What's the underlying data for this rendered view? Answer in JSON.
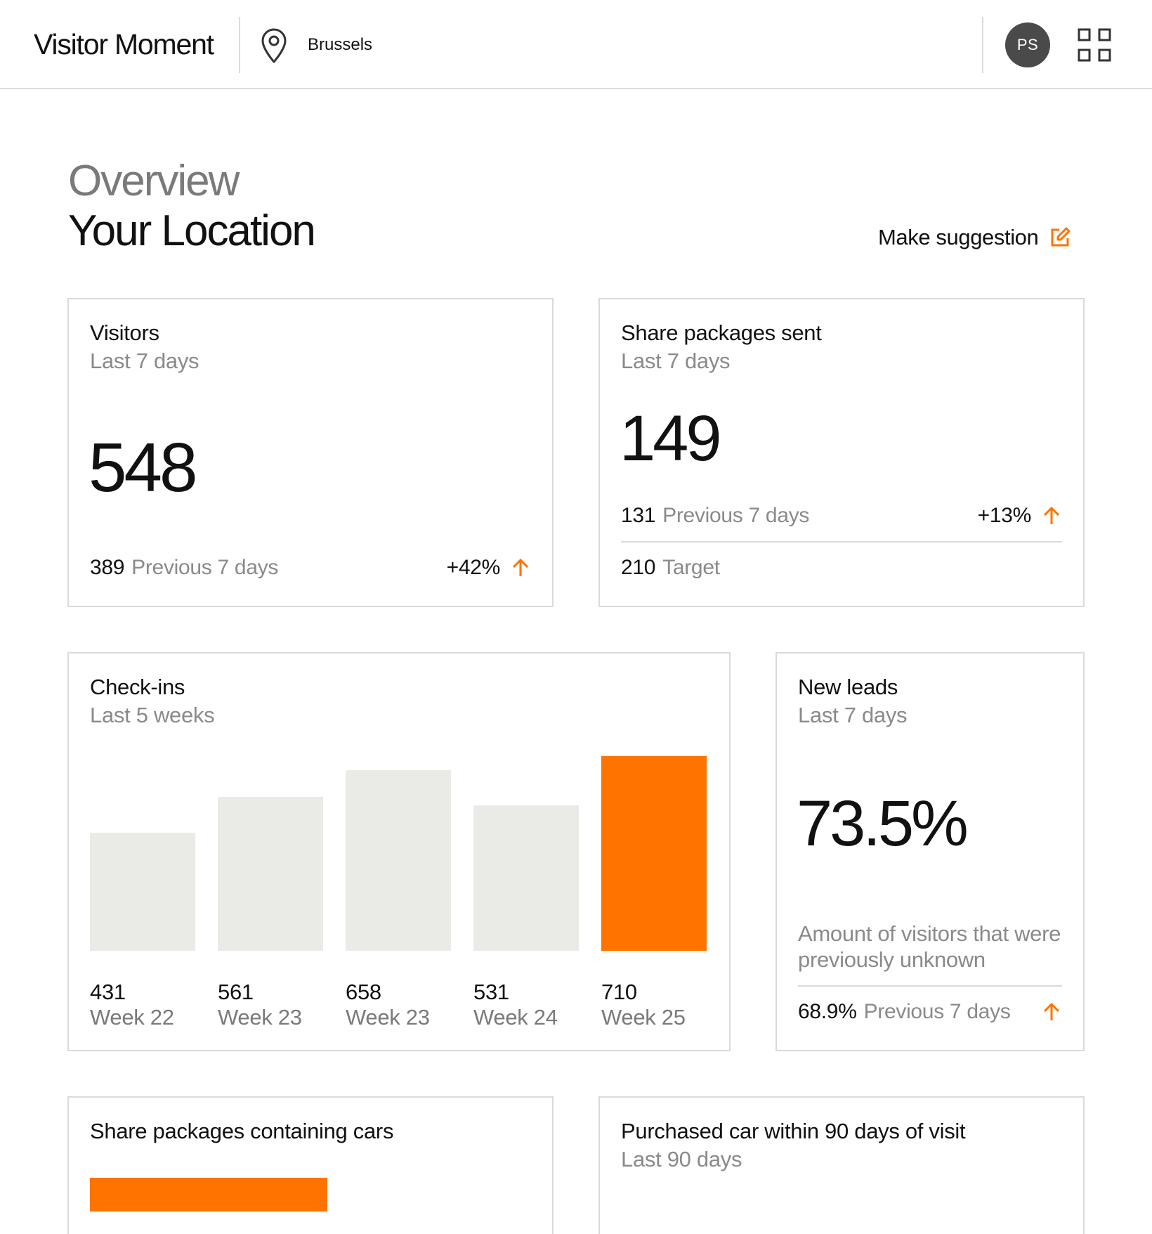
{
  "header": {
    "app_title": "Visitor Moment",
    "location": "Brussels",
    "avatar_initials": "PS",
    "icons": [
      "location-pin-icon",
      "apps-grid-icon"
    ]
  },
  "page": {
    "overview_label": "Overview",
    "title": "Your Location",
    "suggest_label": "Make suggestion",
    "suggest_icon": "edit-icon"
  },
  "colors": {
    "accent": "#FF7300",
    "bar_muted": "#EAEAE6",
    "border": "#DADADA",
    "muted_text": "#8A8A8A"
  },
  "visitors": {
    "title": "Visitors",
    "period": "Last 7 days",
    "value": "548",
    "previous_value": "389",
    "previous_label": "Previous 7 days",
    "change": "+42%",
    "trend": "up"
  },
  "share_packages": {
    "title": "Share packages sent",
    "period": "Last 7 days",
    "value": "149",
    "previous_value": "131",
    "previous_label": "Previous 7 days",
    "change": "+13%",
    "trend": "up",
    "target_value": "210",
    "target_label": "Target"
  },
  "checkins": {
    "title": "Check-ins",
    "period": "Last 5 weeks"
  },
  "chart_data": {
    "type": "bar",
    "title": "Check-ins",
    "subtitle": "Last 5 weeks",
    "categories": [
      "Week 22",
      "Week 23",
      "Week 23",
      "Week 24",
      "Week 25"
    ],
    "values": [
      431,
      561,
      658,
      531,
      710
    ],
    "highlight_index": 4,
    "ylim": [
      0,
      710
    ],
    "grid": false
  },
  "new_leads": {
    "title": "New leads",
    "period": "Last 7 days",
    "value": "73.5%",
    "description": "Amount of visitors that were previously unknown",
    "previous_value": "68.9%",
    "previous_label": "Previous 7 days",
    "trend": "up"
  },
  "share_cars": {
    "title": "Share packages containing cars"
  },
  "purchased": {
    "title": "Purchased car within 90 days of visit",
    "period": "Last 90 days"
  }
}
